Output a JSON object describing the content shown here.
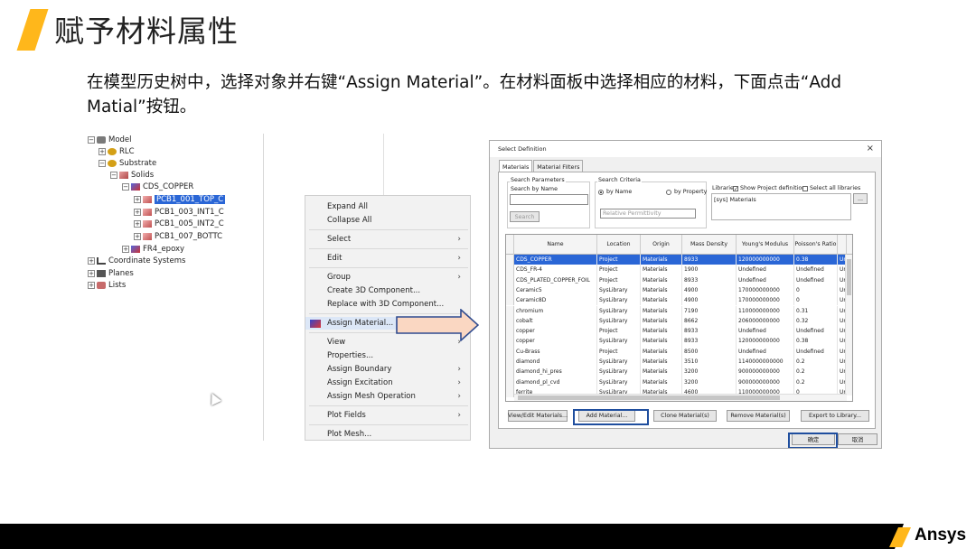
{
  "slide": {
    "title": "赋予材料属性",
    "description": "在模型历史树中，选择对象并右键“Assign Material”。在材料面板中选择相应的材料，下面点击“Add Matial”按钮。",
    "accent_color": "#FFB71B",
    "footer_brand": "Ansys"
  },
  "tree": {
    "items": [
      {
        "label": "Model",
        "icon": "model-icon"
      },
      {
        "label": "RLC",
        "icon": "rlc-icon"
      },
      {
        "label": "Substrate",
        "icon": "substrate-icon"
      },
      {
        "label": "Solids",
        "icon": "solids-icon"
      },
      {
        "label": "CDS_COPPER",
        "icon": "material-icon"
      },
      {
        "label": "PCB1_001_TOP_C",
        "icon": "solid-icon",
        "selected": true
      },
      {
        "label": "PCB1_003_INT1_C",
        "icon": "solid-icon"
      },
      {
        "label": "PCB1_005_INT2_C",
        "icon": "solid-icon"
      },
      {
        "label": "PCB1_007_BOTTC",
        "icon": "solid-icon"
      },
      {
        "label": "FR4_epoxy",
        "icon": "material-icon"
      },
      {
        "label": "Coordinate Systems",
        "icon": "coordinate-icon"
      },
      {
        "label": "Planes",
        "icon": "planes-icon"
      },
      {
        "label": "Lists",
        "icon": "lists-icon"
      }
    ]
  },
  "context_menu": {
    "items": [
      {
        "label": "Expand All",
        "submenu": false
      },
      {
        "label": "Collapse All",
        "submenu": false
      },
      {
        "label": "Select",
        "submenu": true
      },
      {
        "label": "Edit",
        "submenu": true
      },
      {
        "label": "Group",
        "submenu": true
      },
      {
        "label": "Create 3D Component...",
        "submenu": false
      },
      {
        "label": "Replace with 3D Component...",
        "submenu": false
      },
      {
        "label": "Assign Material...",
        "submenu": false,
        "highlighted": true
      },
      {
        "label": "View",
        "submenu": true
      },
      {
        "label": "Properties...",
        "submenu": false
      },
      {
        "label": "Assign Boundary",
        "submenu": true
      },
      {
        "label": "Assign Excitation",
        "submenu": true
      },
      {
        "label": "Assign Mesh Operation",
        "submenu": true
      },
      {
        "label": "Plot Fields",
        "submenu": true
      },
      {
        "label": "Plot Mesh...",
        "submenu": false
      }
    ],
    "arrow_glyph": "›"
  },
  "dialog": {
    "title": "Select Definition",
    "close_glyph": "×",
    "tabs": [
      "Materials",
      "Material Filters"
    ],
    "search_group_label": "Search Parameters",
    "search_by_name_label": "Search by Name",
    "search_button": "Search",
    "criteria_label": "Search Criteria",
    "by_name_label": "by Name",
    "by_property_label": "by Property",
    "property_select_value": "Relative Permittivity",
    "libraries_label": "Libraries",
    "show_project_label": "Show Project definitions",
    "select_all_label": "Select all libraries",
    "libraries_list_item": "[sys] Materials",
    "columns": [
      "Name",
      "Location",
      "Origin",
      "Mass Density",
      "Young's Modulus",
      "Poisson's Ratio",
      "Unc"
    ],
    "rows": [
      {
        "name": "CDS_COPPER",
        "location": "Project",
        "origin": "Materials",
        "mass_density": "8933",
        "youngs": "120000000000",
        "poisson": "0.38",
        "extra": "Unc",
        "selected": true
      },
      {
        "name": "CDS_FR-4",
        "location": "Project",
        "origin": "Materials",
        "mass_density": "1900",
        "youngs": "Undefined",
        "poisson": "Undefined",
        "extra": "Unc"
      },
      {
        "name": "CDS_PLATED_COPPER_FOIL",
        "location": "Project",
        "origin": "Materials",
        "mass_density": "8933",
        "youngs": "Undefined",
        "poisson": "Undefined",
        "extra": "Unc"
      },
      {
        "name": "Ceramic5",
        "location": "SysLibrary",
        "origin": "Materials",
        "mass_density": "4900",
        "youngs": "170000000000",
        "poisson": "0",
        "extra": "Unc"
      },
      {
        "name": "Ceramic8D",
        "location": "SysLibrary",
        "origin": "Materials",
        "mass_density": "4900",
        "youngs": "170000000000",
        "poisson": "0",
        "extra": "Unc"
      },
      {
        "name": "chromium",
        "location": "SysLibrary",
        "origin": "Materials",
        "mass_density": "7190",
        "youngs": "110000000000",
        "poisson": "0.31",
        "extra": "Unc"
      },
      {
        "name": "cobalt",
        "location": "SysLibrary",
        "origin": "Materials",
        "mass_density": "8662",
        "youngs": "206000000000",
        "poisson": "0.32",
        "extra": "Unc"
      },
      {
        "name": "copper",
        "location": "Project",
        "origin": "Materials",
        "mass_density": "8933",
        "youngs": "Undefined",
        "poisson": "Undefined",
        "extra": "Unc"
      },
      {
        "name": "copper",
        "location": "SysLibrary",
        "origin": "Materials",
        "mass_density": "8933",
        "youngs": "120000000000",
        "poisson": "0.38",
        "extra": "Unc"
      },
      {
        "name": "Cu-Brass",
        "location": "Project",
        "origin": "Materials",
        "mass_density": "8500",
        "youngs": "Undefined",
        "poisson": "Undefined",
        "extra": "Unc"
      },
      {
        "name": "diamond",
        "location": "SysLibrary",
        "origin": "Materials",
        "mass_density": "3510",
        "youngs": "1140000000000",
        "poisson": "0.2",
        "extra": "Unc"
      },
      {
        "name": "diamond_hi_pres",
        "location": "SysLibrary",
        "origin": "Materials",
        "mass_density": "3200",
        "youngs": "900000000000",
        "poisson": "0.2",
        "extra": "Unc"
      },
      {
        "name": "diamond_pl_cvd",
        "location": "SysLibrary",
        "origin": "Materials",
        "mass_density": "3200",
        "youngs": "900000000000",
        "poisson": "0.2",
        "extra": "Unc"
      },
      {
        "name": "ferrite",
        "location": "SysLibrary",
        "origin": "Materials",
        "mass_density": "4600",
        "youngs": "110000000000",
        "poisson": "0",
        "extra": "Unc"
      }
    ],
    "buttons": {
      "view_edit": "View/Edit Materials...",
      "add": "Add Material...",
      "clone": "Clone Material(s)",
      "remove": "Remove Material(s)",
      "export": "Export to Library...",
      "ok": "确定",
      "cancel": "取消"
    }
  }
}
